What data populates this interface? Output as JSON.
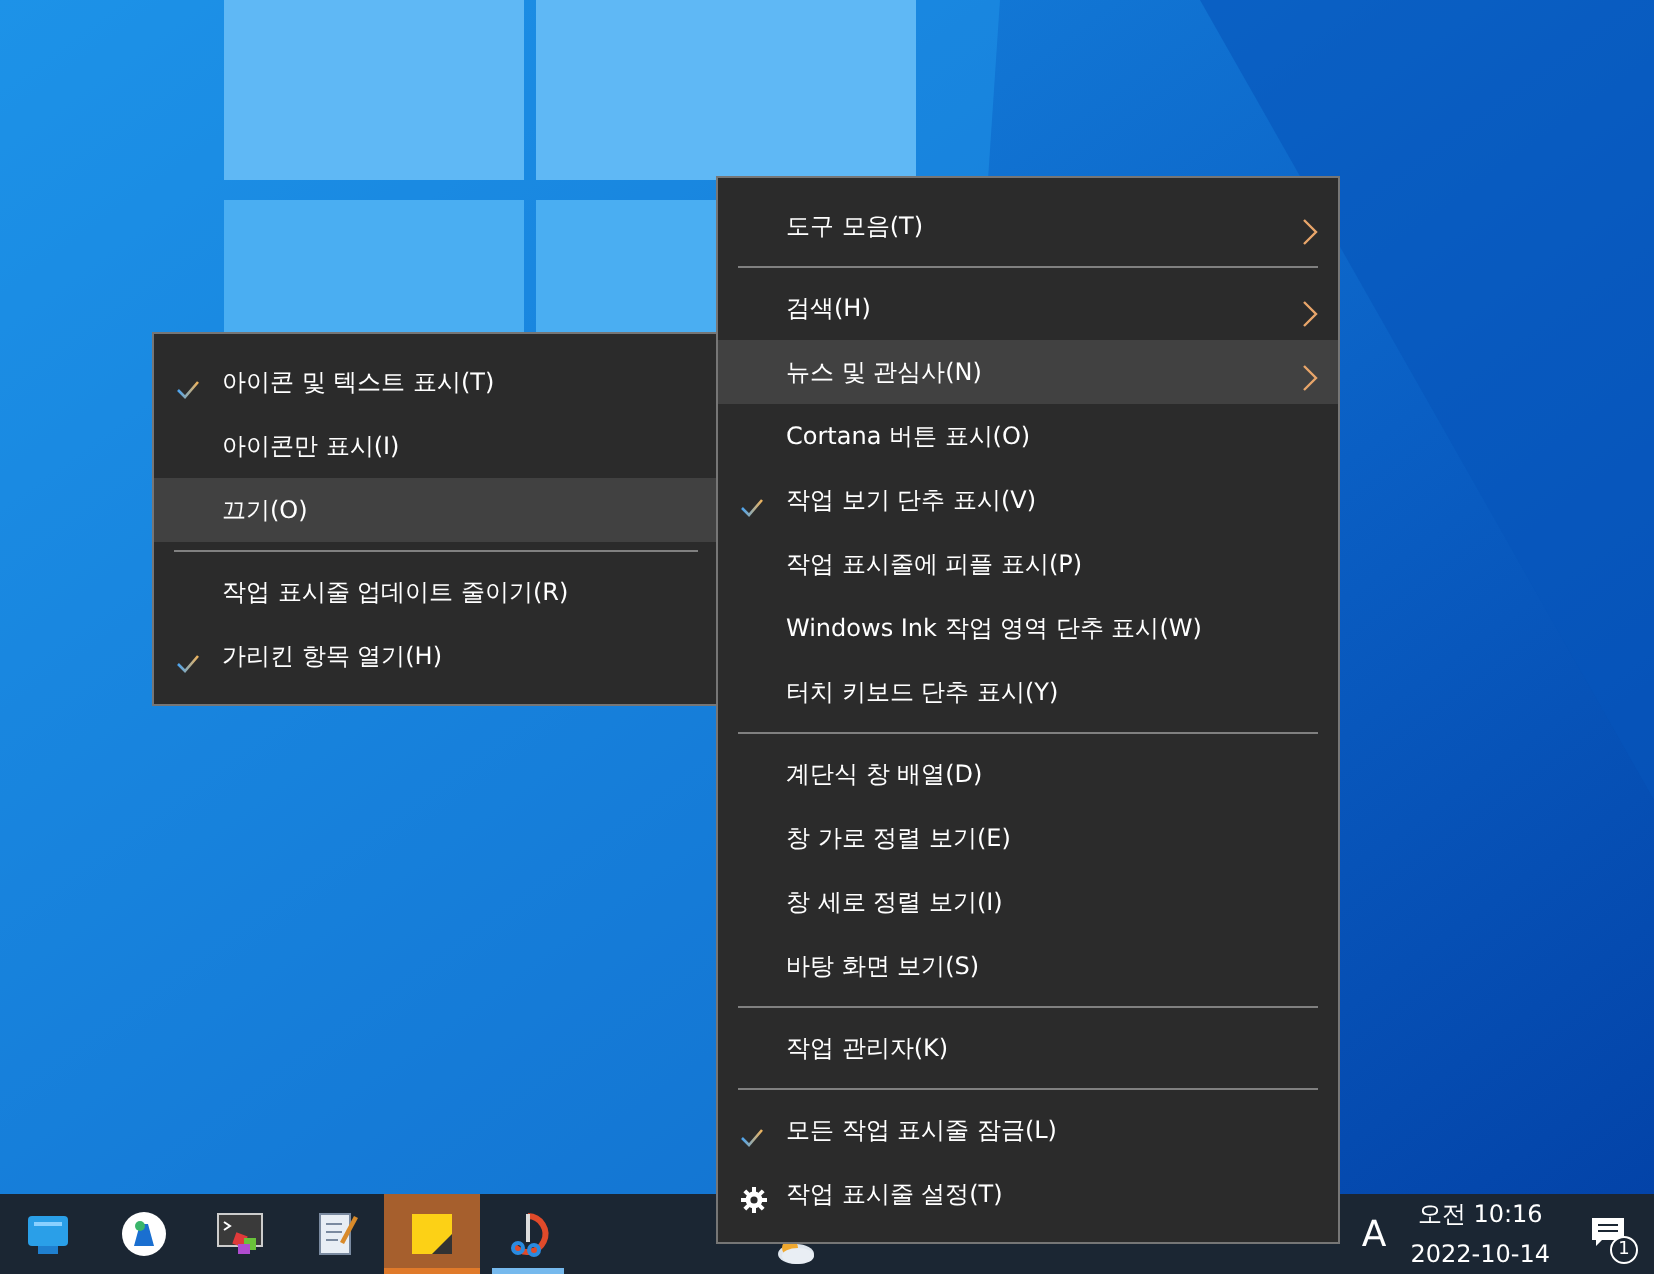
{
  "main_menu": {
    "items": [
      {
        "kind": "item",
        "label": "도구 모음(T)",
        "checked": false,
        "submenu_arrow": true,
        "highlighted": false
      },
      {
        "kind": "separator"
      },
      {
        "kind": "item",
        "label": "검색(H)",
        "checked": false,
        "submenu_arrow": true,
        "highlighted": false
      },
      {
        "kind": "item",
        "label": "뉴스 및 관심사(N)",
        "checked": false,
        "submenu_arrow": true,
        "highlighted": true
      },
      {
        "kind": "item",
        "label": "Cortana 버튼 표시(O)",
        "checked": false,
        "submenu_arrow": false,
        "highlighted": false
      },
      {
        "kind": "item",
        "label": "작업 보기 단추 표시(V)",
        "checked": true,
        "submenu_arrow": false,
        "highlighted": false
      },
      {
        "kind": "item",
        "label": "작업 표시줄에 피플 표시(P)",
        "checked": false,
        "submenu_arrow": false,
        "highlighted": false
      },
      {
        "kind": "item",
        "label": "Windows Ink 작업 영역 단추 표시(W)",
        "checked": false,
        "submenu_arrow": false,
        "highlighted": false
      },
      {
        "kind": "item",
        "label": "터치 키보드 단추 표시(Y)",
        "checked": false,
        "submenu_arrow": false,
        "highlighted": false
      },
      {
        "kind": "separator"
      },
      {
        "kind": "item",
        "label": "계단식 창 배열(D)",
        "checked": false,
        "submenu_arrow": false,
        "highlighted": false
      },
      {
        "kind": "item",
        "label": "창 가로 정렬 보기(E)",
        "checked": false,
        "submenu_arrow": false,
        "highlighted": false
      },
      {
        "kind": "item",
        "label": "창 세로 정렬 보기(I)",
        "checked": false,
        "submenu_arrow": false,
        "highlighted": false
      },
      {
        "kind": "item",
        "label": "바탕 화면 보기(S)",
        "checked": false,
        "submenu_arrow": false,
        "highlighted": false
      },
      {
        "kind": "separator"
      },
      {
        "kind": "item",
        "label": "작업 관리자(K)",
        "checked": false,
        "submenu_arrow": false,
        "highlighted": false
      },
      {
        "kind": "separator"
      },
      {
        "kind": "item",
        "label": "모든 작업 표시줄 잠금(L)",
        "checked": true,
        "submenu_arrow": false,
        "highlighted": false
      },
      {
        "kind": "gear-item",
        "label": "작업 표시줄 설정(T)",
        "checked": false,
        "submenu_arrow": false,
        "highlighted": false
      }
    ]
  },
  "submenu": {
    "items": [
      {
        "kind": "item",
        "label": "아이콘 및 텍스트 표시(T)",
        "checked": true,
        "highlighted": false
      },
      {
        "kind": "item",
        "label": "아이콘만 표시(I)",
        "checked": false,
        "highlighted": false
      },
      {
        "kind": "item",
        "label": "끄기(O)",
        "checked": false,
        "highlighted": true
      },
      {
        "kind": "separator"
      },
      {
        "kind": "item",
        "label": "작업 표시줄 업데이트 줄이기(R)",
        "checked": false,
        "highlighted": false
      },
      {
        "kind": "item",
        "label": "가리킨 항목 열기(H)",
        "checked": true,
        "highlighted": false
      }
    ]
  },
  "taskbar": {
    "apps": [
      {
        "kind": "desktop",
        "selected": false,
        "running": false
      },
      {
        "kind": "circle-app",
        "selected": false,
        "running": false
      },
      {
        "kind": "terminal",
        "selected": false,
        "running": false
      },
      {
        "kind": "notepad",
        "selected": false,
        "running": false
      },
      {
        "kind": "sticky",
        "selected": true,
        "running": true
      },
      {
        "kind": "scissors",
        "selected": false,
        "running": true
      }
    ],
    "input_indicator": "A",
    "time": "오전 10:16",
    "date": "2022-10-14",
    "notification_count": "1"
  }
}
